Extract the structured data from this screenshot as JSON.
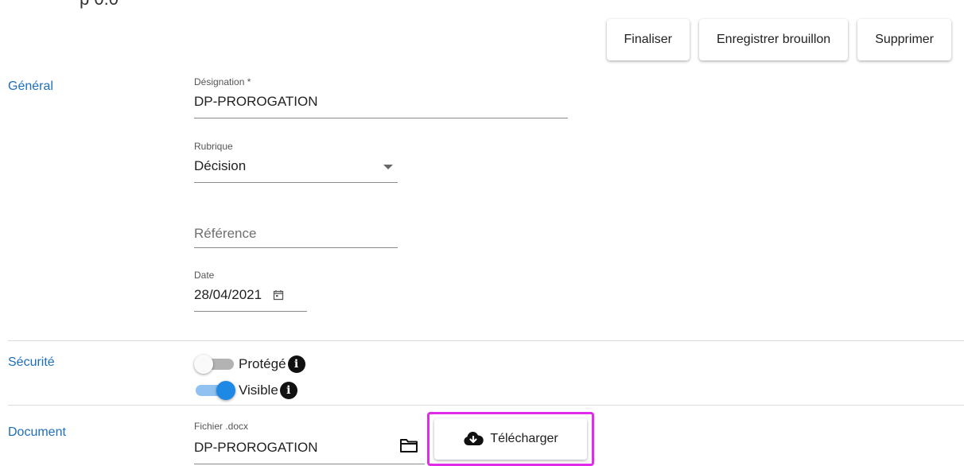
{
  "header": {
    "clipped_text": "p 0.0"
  },
  "toolbar": {
    "finalize_label": "Finaliser",
    "save_draft_label": "Enregistrer brouillon",
    "delete_label": "Supprimer"
  },
  "sections": {
    "general": {
      "title": "Général",
      "designation": {
        "label": "Désignation *",
        "value": "DP-PROROGATION"
      },
      "rubrique": {
        "label": "Rubrique",
        "value": "Décision"
      },
      "reference": {
        "placeholder": "Référence"
      },
      "date": {
        "label": "Date",
        "value": "28/04/2021"
      }
    },
    "security": {
      "title": "Sécurité",
      "protected": {
        "label": "Protégé",
        "checked": false
      },
      "visible": {
        "label": "Visible",
        "checked": true
      }
    },
    "document": {
      "title": "Document",
      "file": {
        "label": "Fichier .docx",
        "value": "DP-PROROGATION"
      },
      "upload_label": "Télécharger"
    }
  },
  "colors": {
    "section_title": "#1e6fba",
    "switch_on": "#1e88e5",
    "highlight": "#e02ce8"
  },
  "icons": {
    "info": "info-icon",
    "calendar": "calendar-icon",
    "folder": "folder-icon",
    "cloud_download": "cloud-download-icon",
    "dropdown": "chevron-down-icon"
  }
}
